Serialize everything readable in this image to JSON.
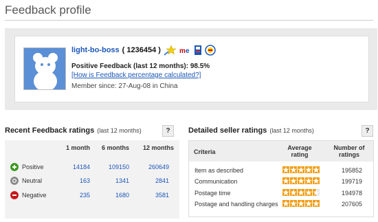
{
  "page": {
    "title": "Feedback profile"
  },
  "profile": {
    "username": "light-bo-boss",
    "score_prefix": "(",
    "score": "1236454",
    "score_suffix": ")",
    "positive_label": "Positive Feedback (last 12 months): 98.5%",
    "calc_link": "[How is Feedback percentage calculated?]",
    "member_since": "Member since: 27-Aug-08 in China",
    "badges": [
      "shooting-star-icon",
      "me-icon",
      "power-seller-icon",
      "top-rated-seller-icon"
    ]
  },
  "recent": {
    "title": "Recent Feedback ratings",
    "subtitle": "(last 12 months)",
    "help": "?",
    "columns": [
      "1 month",
      "6 months",
      "12 months"
    ],
    "rows": [
      {
        "label": "Positive",
        "icon": "plus-icon",
        "color": "#3a9a1e",
        "values": [
          "14184",
          "109150",
          "260649"
        ]
      },
      {
        "label": "Neutral",
        "icon": "neutral-icon",
        "color": "#888888",
        "values": [
          "163",
          "1341",
          "2841"
        ]
      },
      {
        "label": "Negative",
        "icon": "minus-icon",
        "color": "#c8171b",
        "values": [
          "235",
          "1680",
          "3581"
        ]
      }
    ]
  },
  "detailed": {
    "title": "Detailed seller ratings",
    "subtitle": "(last 12 months)",
    "help": "?",
    "col_criteria": "Criteria",
    "col_avg": "Average rating",
    "col_num": "Number of ratings",
    "rows": [
      {
        "criteria": "Item as described",
        "rating": 5,
        "count": "195852"
      },
      {
        "criteria": "Communication",
        "rating": 5,
        "count": "199719"
      },
      {
        "criteria": "Postage time",
        "rating": 4.5,
        "count": "194978"
      },
      {
        "criteria": "Postage and handling charges",
        "rating": 5,
        "count": "207605"
      }
    ],
    "star_color": "#f39c12"
  }
}
